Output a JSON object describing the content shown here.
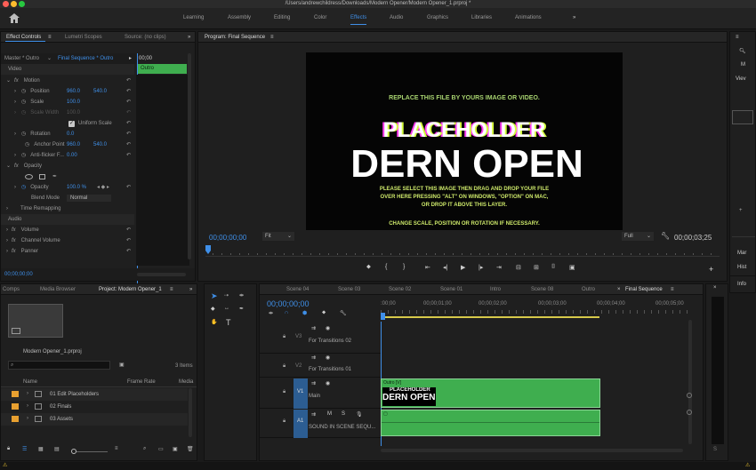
{
  "title_bar": {
    "text": "/Users/andrewchildress/Downloads/Modern Opener/Modern Opener_1.prproj *"
  },
  "workspaces": [
    "Learning",
    "Assembly",
    "Editing",
    "Color",
    "Effects",
    "Audio",
    "Graphics",
    "Libraries",
    "Animations"
  ],
  "effect_controls": {
    "tabs": [
      "Effect Controls",
      "Lumetri Scopes",
      "Source: (no clips)"
    ],
    "master": "Master * Outro",
    "sequence": "Final Sequence * Outro",
    "time": "00;00",
    "clip_label": "Outro",
    "video_label": "Video",
    "motion": "Motion",
    "position_label": "Position",
    "position_x": "960.0",
    "position_y": "540.0",
    "scale_label": "Scale",
    "scale_val": "100.0",
    "scale_width_label": "Scale Width",
    "scale_width_val": "100.0",
    "uniform_label": "Uniform Scale",
    "rotation_label": "Rotation",
    "rotation_val": "0.0",
    "anchor_label": "Anchor Point",
    "anchor_x": "960.0",
    "anchor_y": "540.0",
    "flicker_label": "Anti-flicker F...",
    "flicker_val": "0.00",
    "opacity_section": "Opacity",
    "opacity_label": "Opacity",
    "opacity_val": "100.0 %",
    "blend_label": "Blend Mode",
    "blend_val": "Normal",
    "time_remap": "Time Remapping",
    "audio_label": "Audio",
    "volume": "Volume",
    "channel_volume": "Channel Volume",
    "panner": "Panner",
    "timecode": "00;00;00;00"
  },
  "program": {
    "title": "Program: Final Sequence",
    "line1": "REPLACE THIS FILE BY YOURS IMAGE OR VIDEO.",
    "placeholder": "PLACEHOLDER",
    "big": "DERN OPEN",
    "line2": "PLEASE SELECT THIS IMAGE THEN DRAG AND DROP YOUR FILE",
    "line3": "OVER HERE PRESSING \"ALT\" ON WINDOWS, \"OPTION\" ON MAC,",
    "line4": "OR DROP IT ABOVE THIS LAYER.",
    "line5": "CHANGE SCALE, POSITION OR ROTATION IF NECESSARY.",
    "timecode_left": "00;00;00;00",
    "fit": "Fit",
    "full": "Full",
    "timecode_right": "00;00;03;25"
  },
  "right_panel": {
    "items": [
      "Viev",
      "Mar",
      "Hist",
      "Info"
    ]
  },
  "project": {
    "tabs": [
      "Comps",
      "Media Browser",
      "Project: Modern Opener_1"
    ],
    "file": "Modern Opener_1.prproj",
    "count": "3 Items",
    "col_name": "Name",
    "col_rate": "Frame Rate",
    "col_media": "Media",
    "items": [
      "01 Edit Placeholders",
      "02 Finals",
      "03 Assets"
    ]
  },
  "timeline": {
    "tabs": [
      "Scene 04",
      "Scene 03",
      "Scene 02",
      "Scene 01",
      "Intro",
      "Scene 08",
      "Outro",
      "Final Sequence"
    ],
    "timecode": "00;00;00;00",
    "ruler": [
      ":00;00",
      "00;00;01;00",
      "00;00;02;00",
      "00;00;03;00",
      "00;00;04;00",
      "00;00;05;00"
    ],
    "tracks": [
      {
        "id": "V3",
        "name": "For Transitions 02"
      },
      {
        "id": "V2",
        "name": "For Transitions 01"
      },
      {
        "id": "V1",
        "name": "Main"
      },
      {
        "id": "A1",
        "name": "SOUND IN SCENE SEQU..."
      }
    ],
    "clip_label": "Outro [V]",
    "clip_thumb_a": "PLACEHOLDER",
    "clip_thumb_b": "DERN OPEN"
  },
  "colors": {
    "accent": "#3f8fe8",
    "clip": "#3fae4f",
    "folder": "#e8a030"
  }
}
